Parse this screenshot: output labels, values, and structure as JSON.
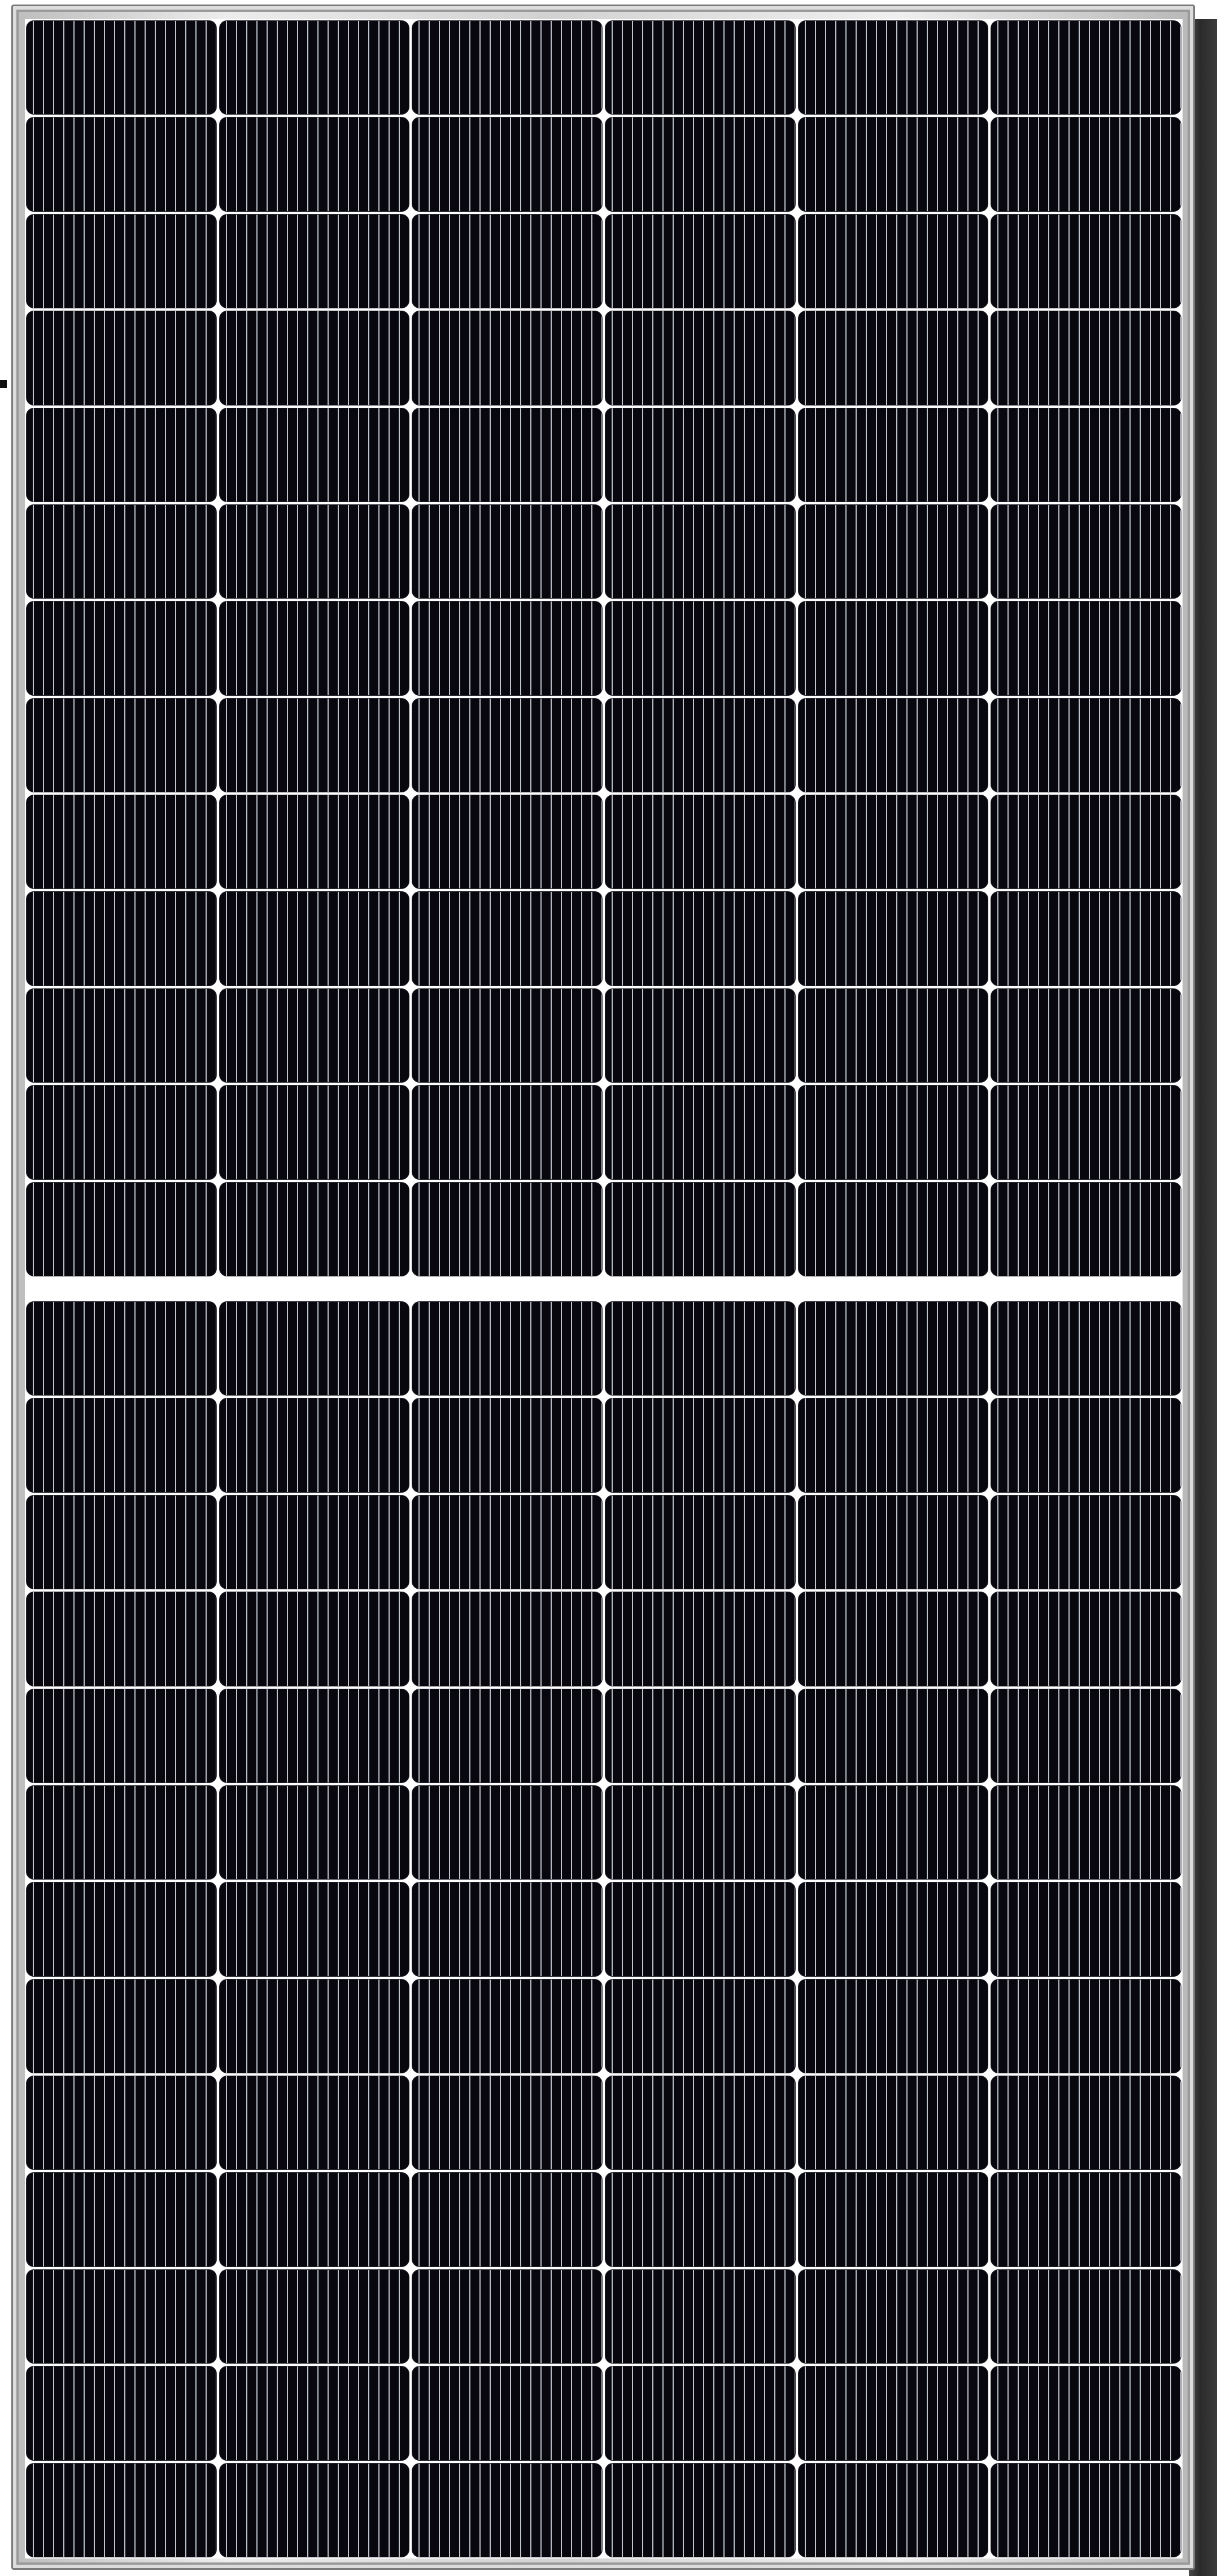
{
  "image": {
    "subject": "solar-panel",
    "cell_columns": 6,
    "cell_rows_per_half": 13,
    "halves": 2,
    "colors": {
      "cell": "#07070d",
      "busbar": "#bfc3cc",
      "frame": "#d9d9d9",
      "gap": "#ffffff",
      "shadow": "#2f2f2f"
    }
  }
}
